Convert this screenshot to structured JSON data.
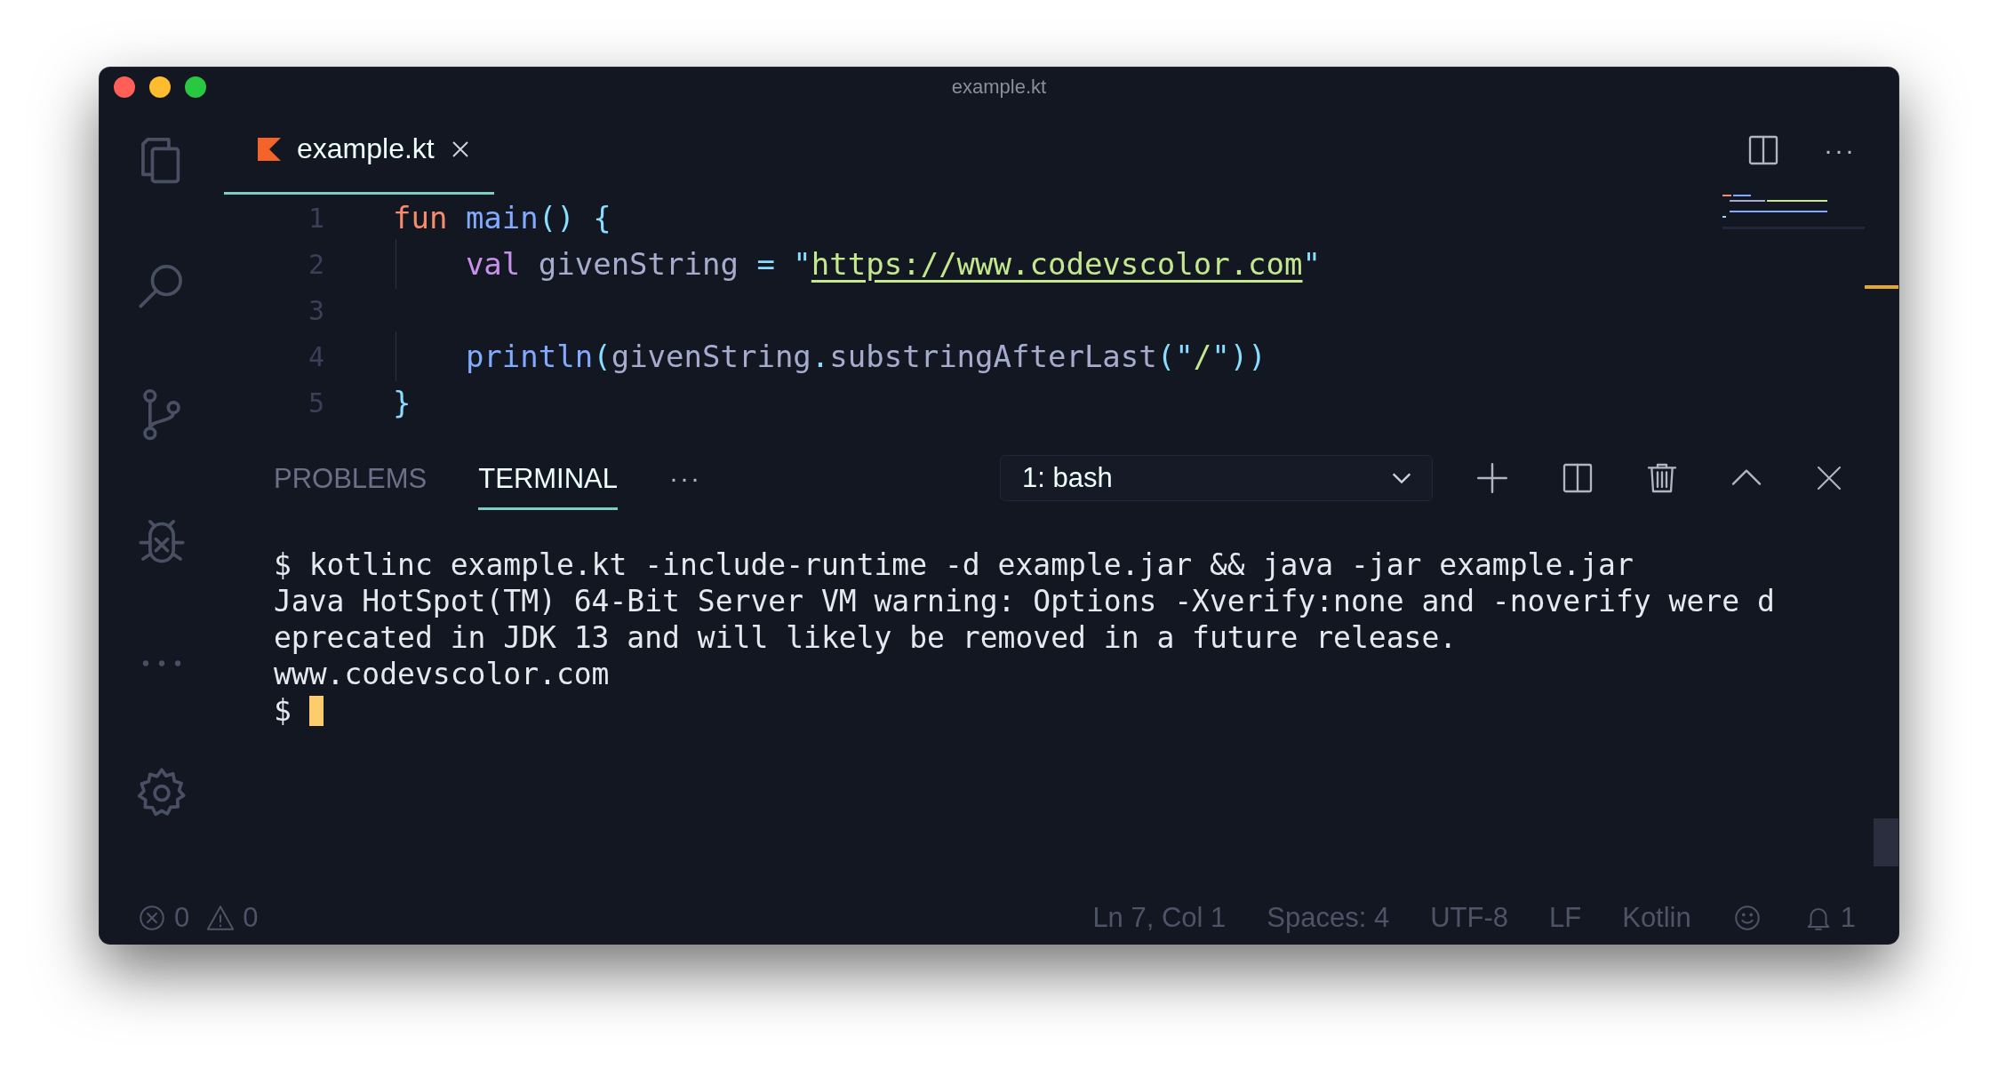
{
  "window": {
    "title": "example.kt"
  },
  "editor_tabs": [
    {
      "label": "example.kt",
      "selected": true
    }
  ],
  "editor_more": "···",
  "code": {
    "lines": [
      {
        "number": "1",
        "tokens": [
          {
            "text": "fun",
            "kind": "keyword"
          },
          {
            "text": " main",
            "kind": "function"
          },
          {
            "text": "()",
            "kind": "punct"
          },
          {
            "text": " {",
            "kind": "punct"
          }
        ]
      },
      {
        "number": "2",
        "tokens": [
          {
            "text": "    val",
            "kind": "declaration"
          },
          {
            "text": " givenString ",
            "kind": "plain"
          },
          {
            "text": "=",
            "kind": "punct"
          },
          {
            "text": " \"",
            "kind": "punct"
          },
          {
            "text": "https://www.codevscolor.com",
            "kind": "link"
          },
          {
            "text": "\"",
            "kind": "punct"
          }
        ]
      },
      {
        "number": "3"
      },
      {
        "number": "4",
        "tokens": [
          {
            "text": "    println",
            "kind": "function"
          },
          {
            "text": "(",
            "kind": "punct"
          },
          {
            "text": "givenString",
            "kind": "plain"
          },
          {
            "text": ".",
            "kind": "punct"
          },
          {
            "text": "substringAfterLast",
            "kind": "plain"
          },
          {
            "text": "(\"",
            "kind": "punct"
          },
          {
            "text": "/",
            "kind": "string"
          },
          {
            "text": "\"))",
            "kind": "punct"
          }
        ]
      },
      {
        "number": "5",
        "tokens": [
          {
            "text": "}",
            "kind": "punct"
          }
        ]
      }
    ]
  },
  "panel": {
    "tabs": [
      {
        "label": "PROBLEMS",
        "selected": false
      },
      {
        "label": "TERMINAL",
        "selected": true
      }
    ],
    "more": "···",
    "terminal_select": {
      "value": "1: bash"
    }
  },
  "terminal": {
    "lines": [
      "$ kotlinc example.kt -include-runtime -d example.jar && java -jar example.jar",
      "Java HotSpot(TM) 64-Bit Server VM warning: Options -Xverify:none and -noverify were d",
      "eprecated in JDK 13 and will likely be removed in a future release.",
      "www.codevscolor.com"
    ],
    "prompt": "$"
  },
  "status_bar": {
    "errors": "0",
    "warnings": "0",
    "items": [
      "Ln 7, Col 1",
      "Spaces: 4",
      "UTF-8",
      "LF",
      "Kotlin"
    ],
    "notifications": "1"
  }
}
